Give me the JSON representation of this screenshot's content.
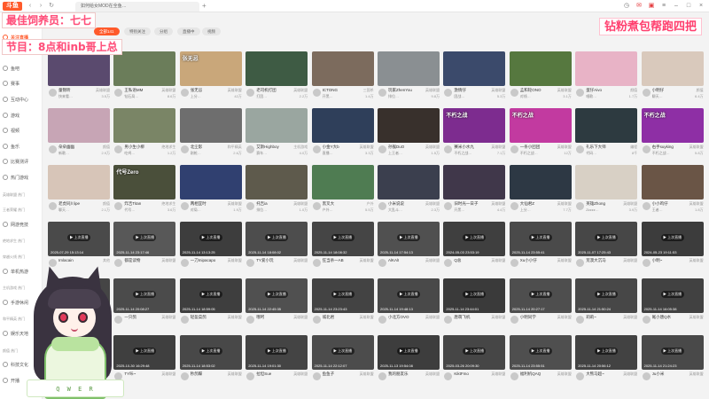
{
  "app": {
    "logo_text": "斗鱼",
    "tab_title": "如何给女MOD在全鱼…",
    "colors": {
      "accent": "#ff5a2b",
      "overlay_text": "#ff4f7a"
    }
  },
  "sidebar": {
    "items": [
      {
        "label": "首页",
        "icon": "home-icon",
        "active": false,
        "sub": false
      },
      {
        "label": "关注直播",
        "icon": "heart-icon",
        "active": true,
        "sub": false
      },
      {
        "label": "全部分类",
        "icon": "grid-icon",
        "active": false,
        "sub": false
      },
      {
        "label": "鱼吧",
        "icon": "fish-icon",
        "active": false,
        "sub": false
      },
      {
        "label": "赛事",
        "icon": "trophy-icon",
        "active": false,
        "sub": false
      },
      {
        "label": "互动中心",
        "icon": "chat-icon",
        "active": false,
        "sub": false
      },
      {
        "label": "游戏",
        "icon": "gamepad-icon",
        "active": false,
        "sub": false
      },
      {
        "label": "视频",
        "icon": "video-icon",
        "active": false,
        "sub": false
      },
      {
        "label": "鱼乐",
        "icon": "music-icon",
        "active": false,
        "sub": false
      },
      {
        "label": "比赛测评",
        "icon": "star-icon",
        "active": false,
        "sub": false
      },
      {
        "label": "热门游戏",
        "icon": "fire-icon",
        "active": false,
        "sub": false
      },
      {
        "label": "英雄联盟 热门",
        "icon": "dot-icon",
        "active": false,
        "sub": true
      },
      {
        "label": "王者荣耀 热门",
        "icon": "dot-icon",
        "active": false,
        "sub": true
      },
      {
        "label": "网游竞技",
        "icon": "sword-icon",
        "active": false,
        "sub": false
      },
      {
        "label": "绝地求生 热门",
        "icon": "dot-icon",
        "active": false,
        "sub": true
      },
      {
        "label": "穿越火线 热门",
        "icon": "dot-icon",
        "active": false,
        "sub": true
      },
      {
        "label": "单机热游",
        "icon": "disc-icon",
        "active": false,
        "sub": false
      },
      {
        "label": "主机游戏 热门",
        "icon": "dot-icon",
        "active": false,
        "sub": true
      },
      {
        "label": "手游休闲",
        "icon": "phone-icon",
        "active": false,
        "sub": false
      },
      {
        "label": "和平精英 热门",
        "icon": "dot-icon",
        "active": false,
        "sub": true
      },
      {
        "label": "娱乐天地",
        "icon": "mic-icon",
        "active": false,
        "sub": false
      },
      {
        "label": "颜值 热门",
        "icon": "dot-icon",
        "active": false,
        "sub": true
      },
      {
        "label": "科技文化",
        "icon": "book-icon",
        "active": false,
        "sub": false
      },
      {
        "label": "开播",
        "icon": "camera-icon",
        "active": false,
        "sub": false
      }
    ]
  },
  "topbar": {
    "filters": [
      {
        "label": "全部141",
        "active": true
      },
      {
        "label": "特别关注",
        "active": false
      },
      {
        "label": "分组",
        "active": false
      },
      {
        "label": "直播中",
        "active": false
      },
      {
        "label": "视频",
        "active": false
      }
    ]
  },
  "overlays": {
    "line1": "最佳饲养员：七七",
    "line2": "节目：8点和inb哥上总",
    "right": "钻粉煮包帮跑四把"
  },
  "vtuber": {
    "keys_label": "Q W E R"
  },
  "cards": [
    {
      "nick": "童锦昕",
      "cate": "英雄联盟",
      "title": "快来看…",
      "hot": "3.5万",
      "cover": "",
      "live": true,
      "color": "#5a4a6e"
    },
    {
      "nick": "王私语MM",
      "cate": "英雄联盟",
      "title": "钻石局…",
      "hot": "8.6万",
      "cover": "",
      "live": true,
      "color": "#6b7d5a"
    },
    {
      "nick": "张无忌",
      "cate": "英雄联盟",
      "title": "上分…",
      "hot": "42万",
      "cover": "张无忌",
      "live": true,
      "color": "#c9a77a"
    },
    {
      "nick": "老司机打团",
      "cate": "英雄联盟",
      "title": "打团…",
      "hot": "2.2万",
      "cover": "",
      "live": true,
      "color": "#3e5b44"
    },
    {
      "nick": "ICTONG",
      "cate": "三国杀",
      "title": "开黑…",
      "hot": "1.4万",
      "cover": "",
      "live": true,
      "color": "#7c6b5d"
    },
    {
      "nick": "玩家ZhenYou",
      "cate": "英雄联盟",
      "title": "排位…",
      "hot": "9.8万",
      "cover": "",
      "live": true,
      "color": "#8a8f92"
    },
    {
      "nick": "激情仔",
      "cate": "英雄联盟",
      "title": "团战…",
      "hot": "5.3万",
      "cover": "",
      "live": true,
      "color": "#3b4a6b"
    },
    {
      "nick": "孟和轮ONO",
      "cate": "英雄联盟",
      "title": "对线…",
      "hot": "3.1万",
      "cover": "",
      "live": true,
      "color": "#56783f"
    },
    {
      "nick": "蛋仔Aivo",
      "cate": "颜值",
      "title": "唱歌…",
      "hot": "1.7万",
      "cover": "",
      "live": true,
      "color": "#e8b3c6"
    },
    {
      "nick": "小明仔",
      "cate": "颜值",
      "title": "聊天…",
      "hot": "6.4万",
      "cover": "",
      "live": true,
      "color": "#d9c9bc"
    },
    {
      "nick": "朵朵幽幽",
      "cate": "颜值",
      "title": "新歌…",
      "hot": "2.9万",
      "cover": "",
      "live": true,
      "color": "#c7a5b5"
    },
    {
      "nick": "男小生小柳",
      "cate": "绝地求生",
      "title": "吃鸡…",
      "hot": "1.2万",
      "cover": "",
      "live": true,
      "color": "#7a8566"
    },
    {
      "nick": "北尘影",
      "cate": "和平精英",
      "title": "刚枪…",
      "hot": "2.6万",
      "cover": "",
      "live": true,
      "color": "#6e6e6e"
    },
    {
      "nick": "艾斯Highboy",
      "cate": "主机游戏",
      "title": "赛车…",
      "hot": "4.0万",
      "cover": "",
      "live": true,
      "color": "#9aa6a0"
    },
    {
      "nick": "小金Y大b",
      "cate": "英雄联盟",
      "title": "直播…",
      "hot": "3.3万",
      "cover": "",
      "live": true,
      "color": "#2f3f5a"
    },
    {
      "nick": "孙猴DuO",
      "cate": "英雄联盟",
      "title": "上王者…",
      "hot": "1.5万",
      "cover": "",
      "live": true,
      "color": "#38302c"
    },
    {
      "nick": "赛米小水九",
      "cate": "英雄联盟",
      "title": "不朽之战…",
      "hot": "7.1万",
      "cover": "不朽之战",
      "live": true,
      "color": "#7d2c8f"
    },
    {
      "nick": "一条小团团",
      "cate": "英雄联盟",
      "title": "不朽之战…",
      "hot": "12万",
      "cover": "不朽之战",
      "live": true,
      "color": "#c23aa0"
    },
    {
      "nick": "礼乐下大师",
      "cate": "编程",
      "title": "代码…",
      "hot": "8千",
      "cover": "",
      "live": true,
      "color": "#2d3a40"
    },
    {
      "nick": "右手suyking",
      "cate": "英雄联盟",
      "title": "不朽之战…",
      "hot": "5.8万",
      "cover": "不朽之战",
      "live": true,
      "color": "#8e2fa5"
    },
    {
      "nick": "老虎同川ipe",
      "cate": "颜值",
      "title": "聊天…",
      "hot": "2.1万",
      "cover": "",
      "live": true,
      "color": "#d7c5b8"
    },
    {
      "nick": "炸吉Titan",
      "cate": "绝地求生",
      "title": "代号…",
      "hot": "3.6万",
      "cover": "代号Zero",
      "live": true,
      "color": "#4a4f3a"
    },
    {
      "nick": "两相宜时",
      "cate": "英雄联盟",
      "title": "对局…",
      "hot": "1.9万",
      "cover": "",
      "live": true,
      "color": "#304070"
    },
    {
      "nick": "托吉ia",
      "cate": "英雄联盟",
      "title": "排位…",
      "hot": "1.0万",
      "cover": "",
      "live": true,
      "color": "#5e5a4c"
    },
    {
      "nick": "黑叉大",
      "cate": "户外",
      "title": "户外…",
      "hot": "5.5万",
      "cover": "",
      "live": true,
      "color": "#4f7c52"
    },
    {
      "nick": "小米说说",
      "cate": "英雄联盟",
      "title": "大乱斗…",
      "hot": "2.3万",
      "cover": "",
      "live": true,
      "color": "#3b3f4e"
    },
    {
      "nick": "旧时光一日子",
      "cate": "英雄联盟",
      "title": "开黑…",
      "hot": "4.4万",
      "cover": "",
      "live": true,
      "color": "#40374a"
    },
    {
      "nick": "大仙君Z",
      "cate": "英雄联盟",
      "title": "上分…",
      "hot": "7.7万",
      "cover": "",
      "live": true,
      "color": "#2d3844"
    },
    {
      "nick": "英雄Zhong",
      "cate": "英雄联盟",
      "title": "Zzzzz…",
      "hot": "3.9万",
      "cover": "",
      "live": true,
      "color": "#d8d0c5"
    },
    {
      "nick": "小小鸡仔",
      "cate": "英雄联盟",
      "title": "王者…",
      "hot": "1.8万",
      "cover": "",
      "live": true,
      "color": "#6a5546"
    },
    {
      "nick": "Imlacain",
      "cate": "其他",
      "title": "",
      "hot": "",
      "cover": "",
      "live": false,
      "date": "2025-07-29 15:13:14",
      "color": "#4a4a4a"
    },
    {
      "nick": "都是读物",
      "cate": "英雄联盟",
      "title": "",
      "hot": "",
      "cover": "",
      "live": false,
      "date": "2025-11-14 23:17:46",
      "color": "#585858"
    },
    {
      "nick": "一刀mipacapo",
      "cate": "英雄联盟",
      "title": "",
      "hot": "",
      "cover": "",
      "live": false,
      "date": "2025-11-14 13:13:25",
      "color": "#3d3d3d"
    },
    {
      "nick": "TY爱小玩",
      "cate": "英雄联盟",
      "title": "",
      "hot": "",
      "cover": "",
      "live": false,
      "date": "2025-11-14 18:08:02",
      "color": "#4d4d4d"
    },
    {
      "nick": "狂当杀一AB",
      "cate": "英雄联盟",
      "title": "",
      "hot": "",
      "cover": "",
      "live": false,
      "date": "2025-11-14 18:08:32",
      "color": "#454545"
    },
    {
      "nick": "AlKAlI",
      "cate": "英雄联盟",
      "title": "",
      "hot": "",
      "cover": "",
      "live": false,
      "date": "2025-11-14 17:54:13",
      "color": "#505050"
    },
    {
      "nick": "Q总",
      "cate": "英雄联盟",
      "title": "",
      "hot": "",
      "cover": "",
      "live": false,
      "date": "2024-05-03 23:53:19",
      "color": "#3f3f3f"
    },
    {
      "nick": "Xu小小仔",
      "cate": "英雄联盟",
      "title": "",
      "hot": "",
      "cover": "",
      "live": false,
      "date": "2025-11-14 23:55:41",
      "color": "#4a4a4a"
    },
    {
      "nick": "荒漠大沉马",
      "cate": "英雄联盟",
      "title": "",
      "hot": "",
      "cover": "",
      "live": false,
      "date": "2025-11-07 17:25:43",
      "color": "#474747"
    },
    {
      "nick": "小明~",
      "cate": "英雄联盟",
      "title": "",
      "hot": "",
      "cover": "",
      "live": false,
      "date": "2024-05-23 19:11:53",
      "color": "#3c3c3c"
    },
    {
      "nick": "小浩daduda",
      "cate": "英雄联盟",
      "title": "",
      "hot": "",
      "cover": "",
      "live": false,
      "date": "2025-11-14 23:01:22",
      "color": "#454545"
    },
    {
      "nick": "一只鸽",
      "cate": "英雄联盟",
      "title": "",
      "hot": "",
      "cover": "",
      "live": false,
      "date": "2025-11-14 20:08:27",
      "color": "#4b4b4b"
    },
    {
      "nick": "轻盈菜鸽",
      "cate": "英雄联盟",
      "title": "",
      "hot": "",
      "cover": "",
      "live": false,
      "date": "2025-11-14 18:59:05",
      "color": "#3e3e3e"
    },
    {
      "nick": "哦呵",
      "cate": "英雄联盟",
      "title": "",
      "hot": "",
      "cover": "",
      "live": false,
      "date": "2025-11-14 22:45:35",
      "color": "#505050"
    },
    {
      "nick": "城北君",
      "cate": "英雄联盟",
      "title": "",
      "hot": "",
      "cover": "",
      "live": false,
      "date": "2025-11-14 23:23:43",
      "color": "#434343"
    },
    {
      "nick": "小北方OVO",
      "cate": "英雄联盟",
      "title": "",
      "hot": "",
      "cover": "",
      "live": false,
      "date": "2025-11-14 19:48:13",
      "color": "#494949"
    },
    {
      "nick": "唐萌飞机",
      "cate": "英雄联盟",
      "title": "",
      "hot": "",
      "cover": "",
      "live": false,
      "date": "2025-11-14 23:44:01",
      "color": "#3a3a3a"
    },
    {
      "nick": "小明同学",
      "cate": "英雄联盟",
      "title": "",
      "hot": "",
      "cover": "",
      "live": false,
      "date": "2025-11-14 20:27:17",
      "color": "#4e4e4e"
    },
    {
      "nick": "莉莉~",
      "cate": "英雄联盟",
      "title": "",
      "hot": "",
      "cover": "",
      "live": false,
      "date": "2025-11-14 21:50:24",
      "color": "#474747"
    },
    {
      "nick": "尾小唐Q水",
      "cate": "英雄联盟",
      "title": "",
      "hot": "",
      "cover": "",
      "live": false,
      "date": "2025-11-14 16:05:38",
      "color": "#414141"
    },
    {
      "nick": "小羊",
      "cate": "英雄联盟",
      "title": "",
      "hot": "",
      "cover": "",
      "live": false,
      "date": "2025-11-14 16:45:05",
      "color": "#4a4a4a"
    },
    {
      "nick": "TY咔~",
      "cate": "英雄联盟",
      "title": "",
      "hot": "",
      "cover": "",
      "live": false,
      "date": "2025-10-30 16:29:48",
      "color": "#3f3f3f"
    },
    {
      "nick": "秒鸽蝶",
      "cate": "英雄联盟",
      "title": "",
      "hot": "",
      "cover": "",
      "live": false,
      "date": "2025-11-14 18:53:02",
      "color": "#484848"
    },
    {
      "nick": "拉坦Sue",
      "cate": "英雄联盟",
      "title": "",
      "hot": "",
      "cover": "",
      "live": false,
      "date": "2025-11-14 19:01:30",
      "color": "#444444"
    },
    {
      "nick": "鱼鱼子",
      "cate": "英雄联盟",
      "title": "",
      "hot": "",
      "cover": "",
      "live": false,
      "date": "2025-11-14 22:12:07",
      "color": "#4c4c4c"
    },
    {
      "nick": "我的朋友乐",
      "cate": "英雄联盟",
      "title": "",
      "hot": "",
      "cover": "",
      "live": false,
      "date": "2025-11-13 19:54:08",
      "color": "#3d3d3d"
    },
    {
      "nick": "KiktFmo",
      "cate": "英雄联盟",
      "title": "",
      "hot": "",
      "cover": "",
      "live": false,
      "date": "2025-03-26 20:09:30",
      "color": "#464646"
    },
    {
      "nick": "福利机QAQ",
      "cate": "英雄联盟",
      "title": "",
      "hot": "",
      "cover": "",
      "live": false,
      "date": "2025-11-14 23:55:51",
      "color": "#4f4f4f"
    },
    {
      "nick": "大熊马超~",
      "cate": "英雄联盟",
      "title": "",
      "hot": "",
      "cover": "",
      "live": false,
      "date": "2025-11-14 20:56:12",
      "color": "#424242"
    },
    {
      "nick": "Ju小米",
      "cate": "英雄联盟",
      "title": "",
      "hot": "",
      "cover": "",
      "live": false,
      "date": "2025-11-14 21:24:23",
      "color": "#494949"
    }
  ]
}
